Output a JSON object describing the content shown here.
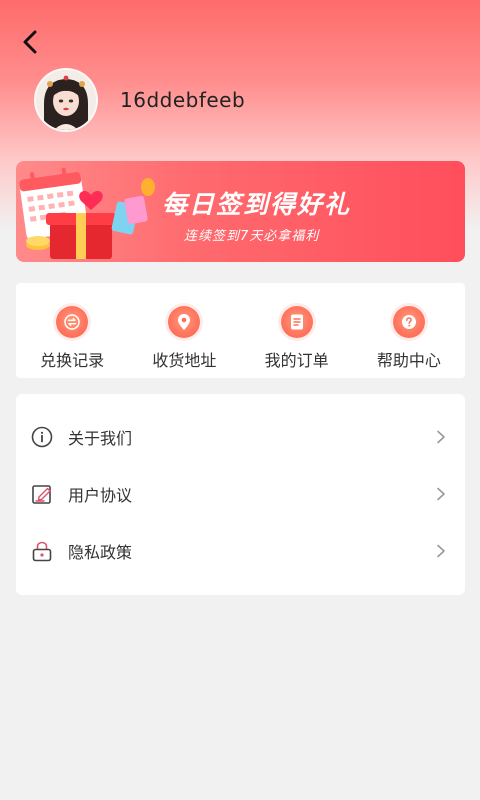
{
  "header": {
    "back_icon": "back-arrow-icon"
  },
  "profile": {
    "username": "16ddebfeeb",
    "avatar": "user-avatar"
  },
  "banner": {
    "title": "每日签到得好礼",
    "subtitle": "连续签到7天必拿福利",
    "colors": {
      "start": "#ff8a8a",
      "end": "#ff4e5c"
    }
  },
  "quick_actions": [
    {
      "label": "兑换记录",
      "icon": "exchange-icon"
    },
    {
      "label": "收货地址",
      "icon": "location-icon"
    },
    {
      "label": "我的订单",
      "icon": "order-icon"
    },
    {
      "label": "帮助中心",
      "icon": "help-icon"
    }
  ],
  "menu": [
    {
      "label": "关于我们",
      "icon": "info-icon"
    },
    {
      "label": "用户协议",
      "icon": "edit-document-icon"
    },
    {
      "label": "隐私政策",
      "icon": "lock-icon"
    }
  ],
  "colors": {
    "accent": "#ff6b6b",
    "icon_orange": "#ff6e5a"
  }
}
